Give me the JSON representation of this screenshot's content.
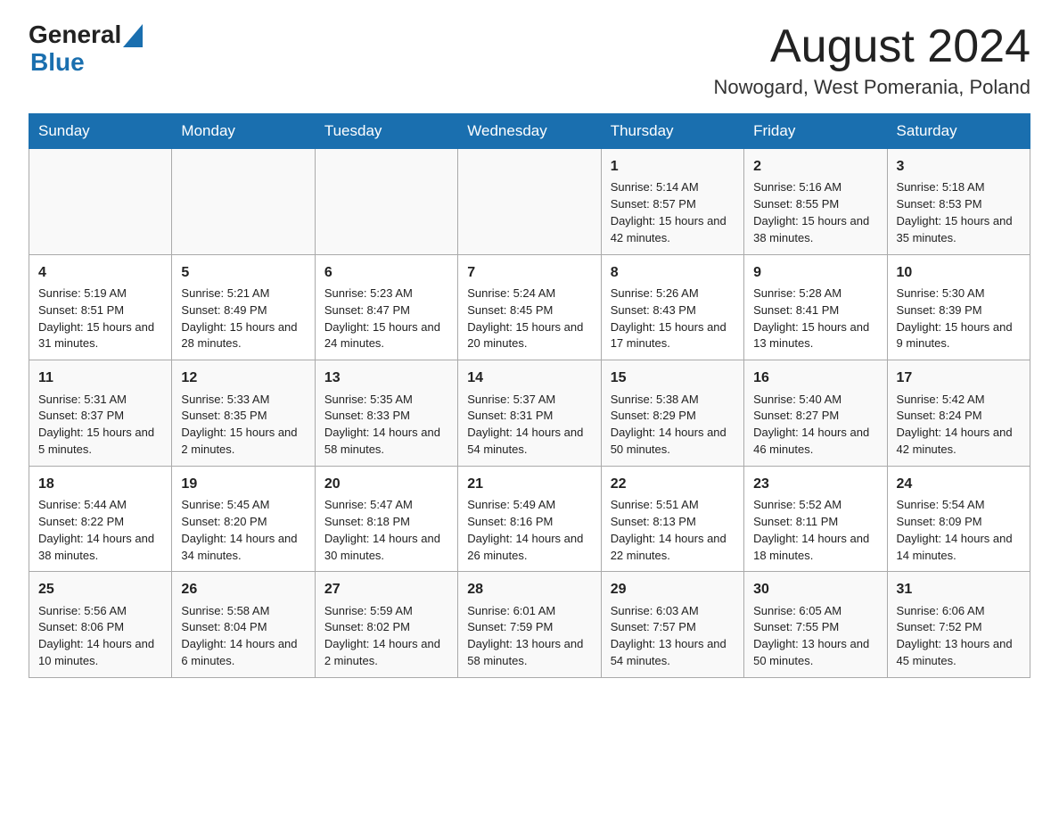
{
  "header": {
    "logo_general": "General",
    "logo_blue": "Blue",
    "month_title": "August 2024",
    "location": "Nowogard, West Pomerania, Poland"
  },
  "days_of_week": [
    "Sunday",
    "Monday",
    "Tuesday",
    "Wednesday",
    "Thursday",
    "Friday",
    "Saturday"
  ],
  "weeks": [
    [
      {
        "day": "",
        "info": ""
      },
      {
        "day": "",
        "info": ""
      },
      {
        "day": "",
        "info": ""
      },
      {
        "day": "",
        "info": ""
      },
      {
        "day": "1",
        "info": "Sunrise: 5:14 AM\nSunset: 8:57 PM\nDaylight: 15 hours and 42 minutes."
      },
      {
        "day": "2",
        "info": "Sunrise: 5:16 AM\nSunset: 8:55 PM\nDaylight: 15 hours and 38 minutes."
      },
      {
        "day": "3",
        "info": "Sunrise: 5:18 AM\nSunset: 8:53 PM\nDaylight: 15 hours and 35 minutes."
      }
    ],
    [
      {
        "day": "4",
        "info": "Sunrise: 5:19 AM\nSunset: 8:51 PM\nDaylight: 15 hours and 31 minutes."
      },
      {
        "day": "5",
        "info": "Sunrise: 5:21 AM\nSunset: 8:49 PM\nDaylight: 15 hours and 28 minutes."
      },
      {
        "day": "6",
        "info": "Sunrise: 5:23 AM\nSunset: 8:47 PM\nDaylight: 15 hours and 24 minutes."
      },
      {
        "day": "7",
        "info": "Sunrise: 5:24 AM\nSunset: 8:45 PM\nDaylight: 15 hours and 20 minutes."
      },
      {
        "day": "8",
        "info": "Sunrise: 5:26 AM\nSunset: 8:43 PM\nDaylight: 15 hours and 17 minutes."
      },
      {
        "day": "9",
        "info": "Sunrise: 5:28 AM\nSunset: 8:41 PM\nDaylight: 15 hours and 13 minutes."
      },
      {
        "day": "10",
        "info": "Sunrise: 5:30 AM\nSunset: 8:39 PM\nDaylight: 15 hours and 9 minutes."
      }
    ],
    [
      {
        "day": "11",
        "info": "Sunrise: 5:31 AM\nSunset: 8:37 PM\nDaylight: 15 hours and 5 minutes."
      },
      {
        "day": "12",
        "info": "Sunrise: 5:33 AM\nSunset: 8:35 PM\nDaylight: 15 hours and 2 minutes."
      },
      {
        "day": "13",
        "info": "Sunrise: 5:35 AM\nSunset: 8:33 PM\nDaylight: 14 hours and 58 minutes."
      },
      {
        "day": "14",
        "info": "Sunrise: 5:37 AM\nSunset: 8:31 PM\nDaylight: 14 hours and 54 minutes."
      },
      {
        "day": "15",
        "info": "Sunrise: 5:38 AM\nSunset: 8:29 PM\nDaylight: 14 hours and 50 minutes."
      },
      {
        "day": "16",
        "info": "Sunrise: 5:40 AM\nSunset: 8:27 PM\nDaylight: 14 hours and 46 minutes."
      },
      {
        "day": "17",
        "info": "Sunrise: 5:42 AM\nSunset: 8:24 PM\nDaylight: 14 hours and 42 minutes."
      }
    ],
    [
      {
        "day": "18",
        "info": "Sunrise: 5:44 AM\nSunset: 8:22 PM\nDaylight: 14 hours and 38 minutes."
      },
      {
        "day": "19",
        "info": "Sunrise: 5:45 AM\nSunset: 8:20 PM\nDaylight: 14 hours and 34 minutes."
      },
      {
        "day": "20",
        "info": "Sunrise: 5:47 AM\nSunset: 8:18 PM\nDaylight: 14 hours and 30 minutes."
      },
      {
        "day": "21",
        "info": "Sunrise: 5:49 AM\nSunset: 8:16 PM\nDaylight: 14 hours and 26 minutes."
      },
      {
        "day": "22",
        "info": "Sunrise: 5:51 AM\nSunset: 8:13 PM\nDaylight: 14 hours and 22 minutes."
      },
      {
        "day": "23",
        "info": "Sunrise: 5:52 AM\nSunset: 8:11 PM\nDaylight: 14 hours and 18 minutes."
      },
      {
        "day": "24",
        "info": "Sunrise: 5:54 AM\nSunset: 8:09 PM\nDaylight: 14 hours and 14 minutes."
      }
    ],
    [
      {
        "day": "25",
        "info": "Sunrise: 5:56 AM\nSunset: 8:06 PM\nDaylight: 14 hours and 10 minutes."
      },
      {
        "day": "26",
        "info": "Sunrise: 5:58 AM\nSunset: 8:04 PM\nDaylight: 14 hours and 6 minutes."
      },
      {
        "day": "27",
        "info": "Sunrise: 5:59 AM\nSunset: 8:02 PM\nDaylight: 14 hours and 2 minutes."
      },
      {
        "day": "28",
        "info": "Sunrise: 6:01 AM\nSunset: 7:59 PM\nDaylight: 13 hours and 58 minutes."
      },
      {
        "day": "29",
        "info": "Sunrise: 6:03 AM\nSunset: 7:57 PM\nDaylight: 13 hours and 54 minutes."
      },
      {
        "day": "30",
        "info": "Sunrise: 6:05 AM\nSunset: 7:55 PM\nDaylight: 13 hours and 50 minutes."
      },
      {
        "day": "31",
        "info": "Sunrise: 6:06 AM\nSunset: 7:52 PM\nDaylight: 13 hours and 45 minutes."
      }
    ]
  ]
}
